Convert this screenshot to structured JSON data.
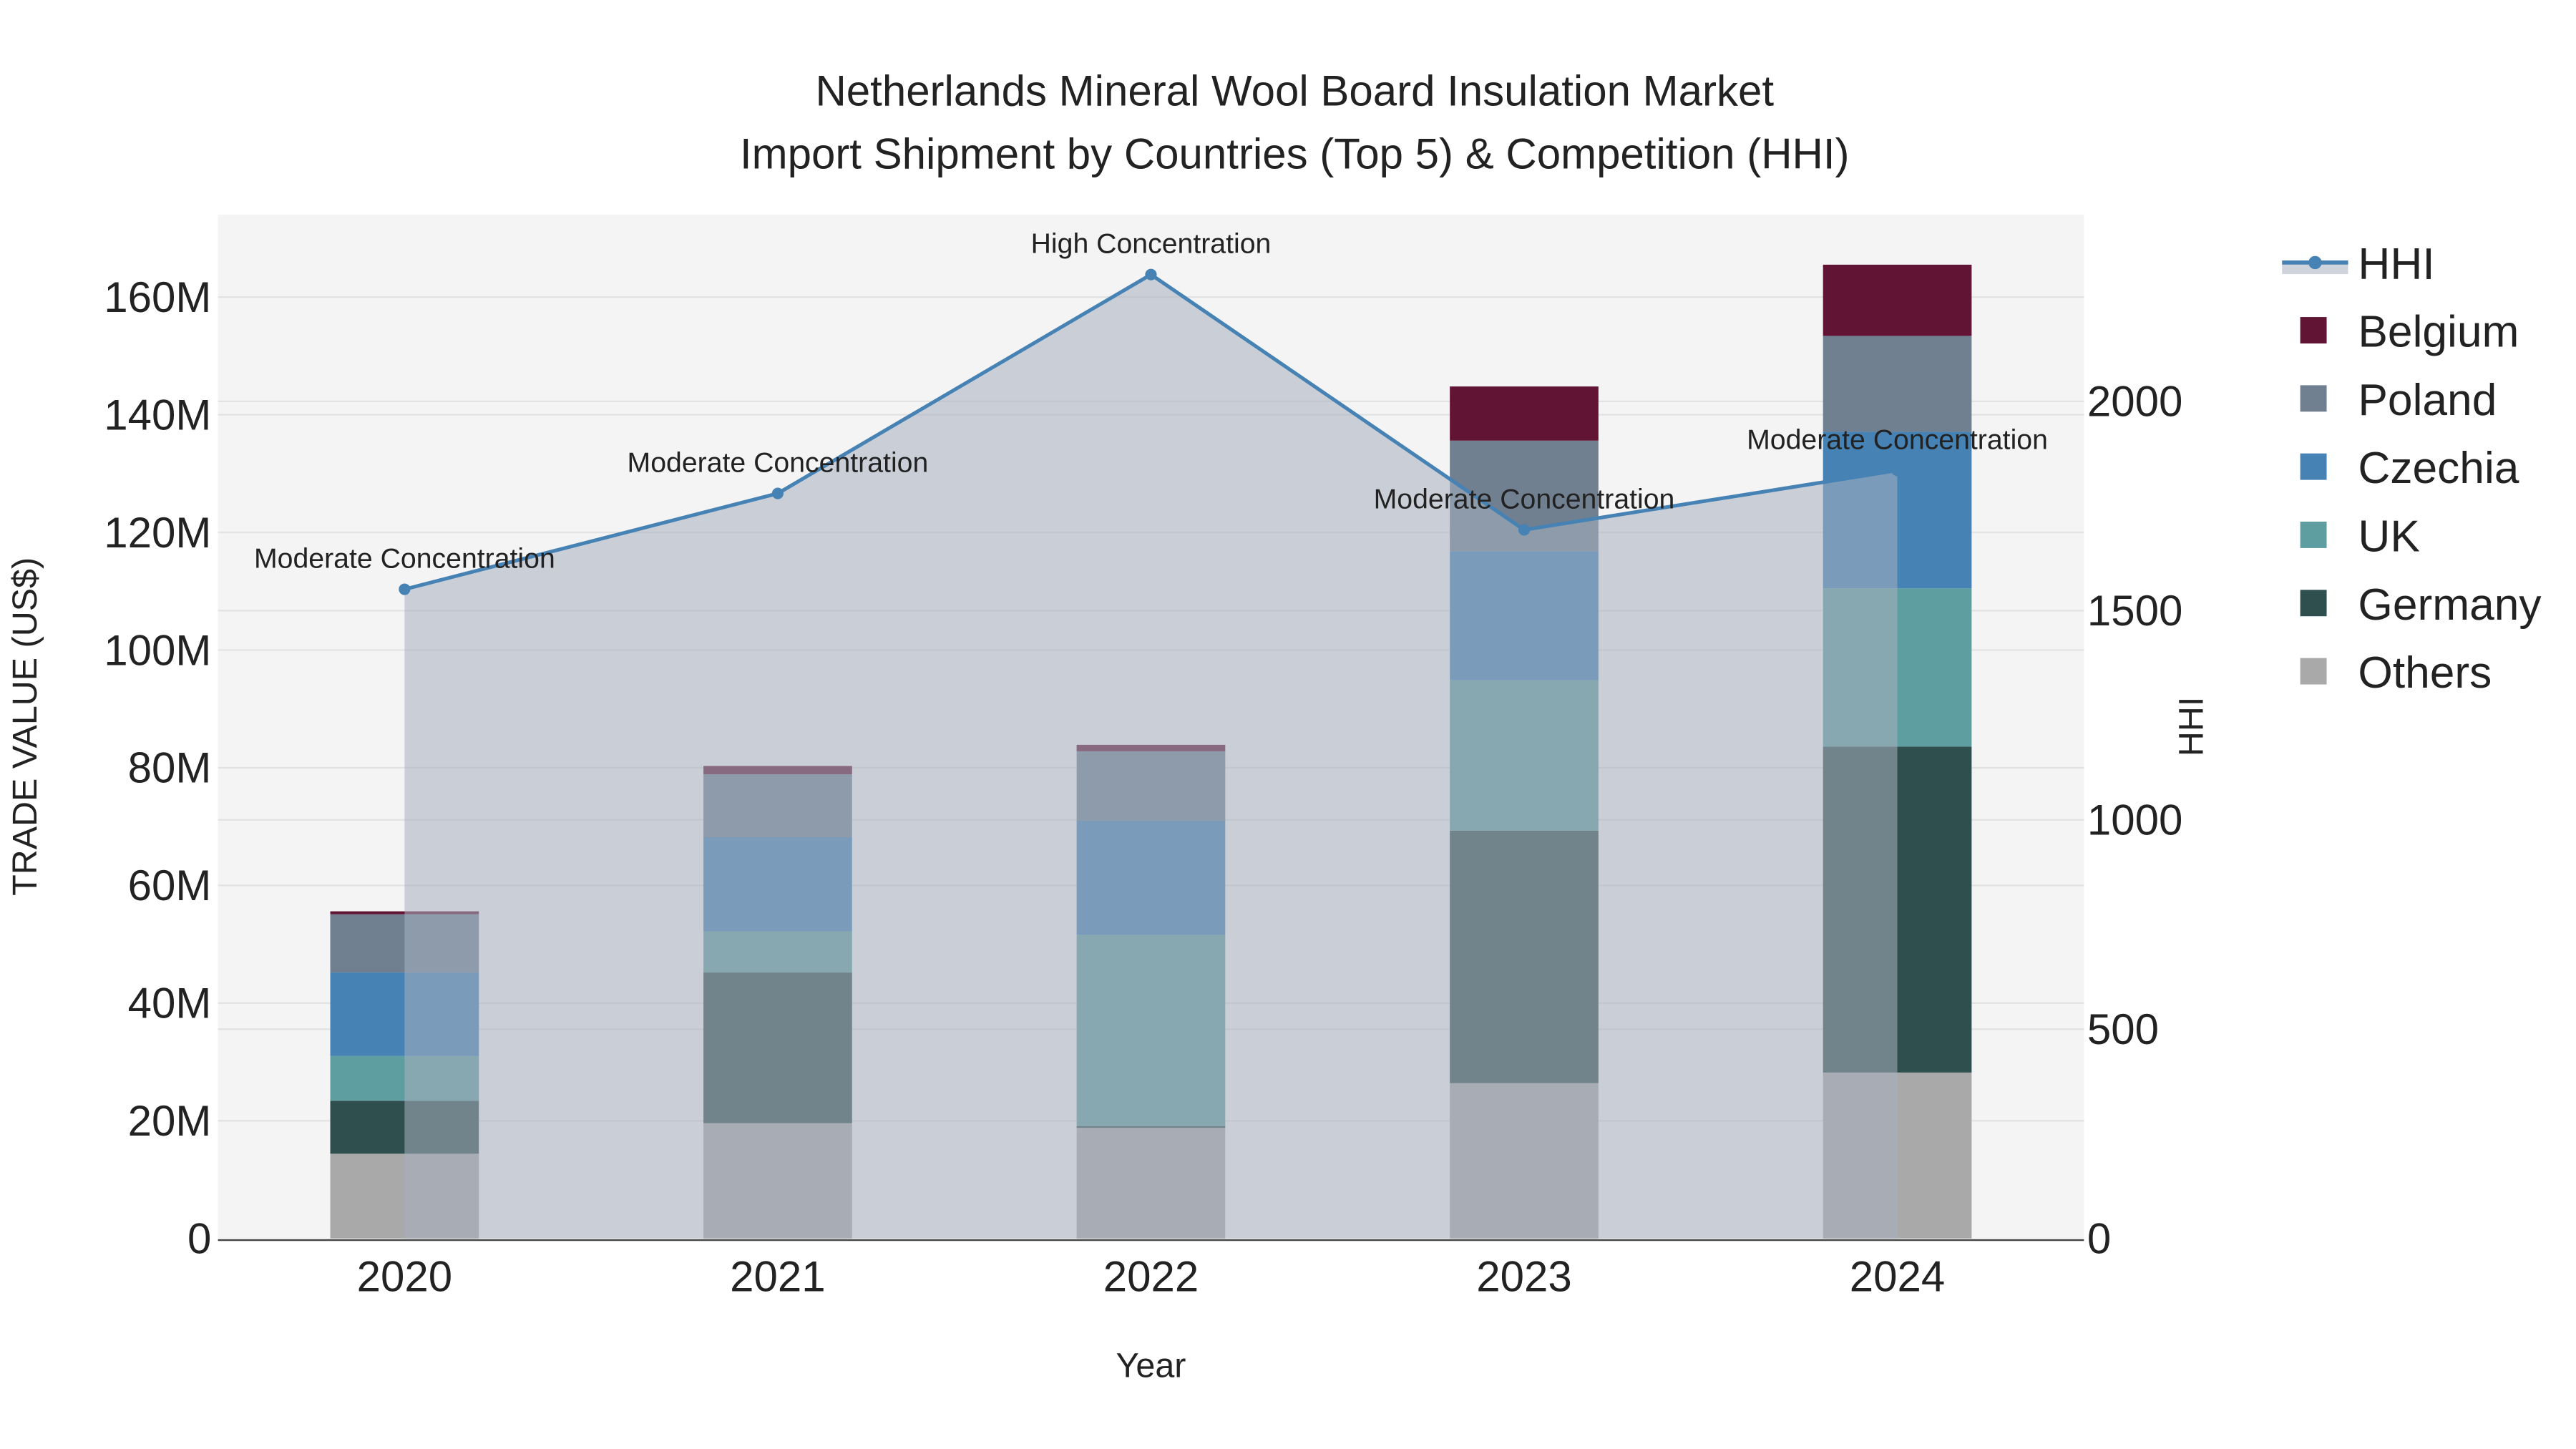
{
  "chart_data": {
    "type": "bar",
    "title_line1": "Netherlands Mineral Wool Board Insulation Market",
    "title_line2": "Import Shipment by Countries (Top 5) & Competition (HHI)",
    "xlabel": "Year",
    "ylabel": "TRADE VALUE (US$)",
    "y2label": "HHI",
    "categories": [
      "2020",
      "2021",
      "2022",
      "2023",
      "2024"
    ],
    "ylim": [
      0,
      174
    ],
    "y_unit": "M",
    "y_ticks": [
      0,
      20,
      40,
      60,
      80,
      100,
      120,
      140,
      160
    ],
    "y_tick_labels": [
      "0",
      "20M",
      "40M",
      "60M",
      "80M",
      "100M",
      "120M",
      "140M",
      "160M"
    ],
    "y2lim": [
      0,
      2446
    ],
    "y2_ticks": [
      0,
      500,
      1000,
      1500,
      2000
    ],
    "y2_tick_labels": [
      "0",
      "500",
      "1000",
      "1500",
      "2000"
    ],
    "grid": true,
    "legend_placement": "right",
    "series": [
      {
        "name": "Others",
        "color": "#a9a9a9",
        "values": [
          14.4,
          19.6,
          18.8,
          26.4,
          28.2
        ]
      },
      {
        "name": "Germany",
        "color": "#2f4f4f",
        "values": [
          9.0,
          25.6,
          0.3,
          42.9,
          55.4
        ]
      },
      {
        "name": "UK",
        "color": "#5f9ea0",
        "values": [
          7.6,
          7.0,
          32.5,
          25.6,
          26.9
        ]
      },
      {
        "name": "Czechia",
        "color": "#4682b4",
        "values": [
          14.2,
          16.0,
          19.4,
          21.9,
          26.6
        ]
      },
      {
        "name": "Poland",
        "color": "#708090",
        "values": [
          9.9,
          10.7,
          11.8,
          18.8,
          16.3
        ]
      },
      {
        "name": "Belgium",
        "color": "#611434",
        "values": [
          0.5,
          1.4,
          1.1,
          9.2,
          12.1
        ]
      }
    ],
    "hhi": {
      "name": "HHI",
      "color": "#4682b4",
      "values": [
        1551,
        1780,
        2303,
        1693,
        1835
      ],
      "annotations": [
        "Moderate Concentration",
        "Moderate Concentration",
        "High Concentration",
        "Moderate Concentration",
        "Moderate Concentration"
      ]
    },
    "legend_order": [
      "HHI",
      "Belgium",
      "Poland",
      "Czechia",
      "UK",
      "Germany",
      "Others"
    ]
  }
}
